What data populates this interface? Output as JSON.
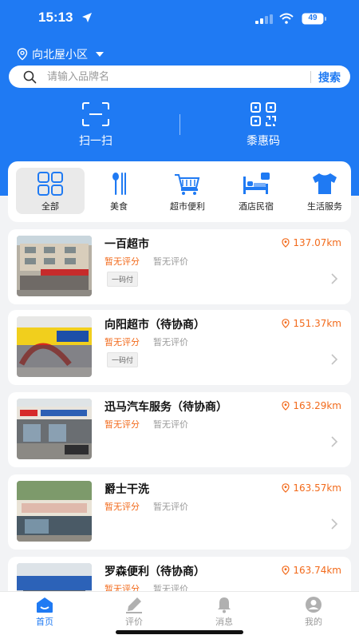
{
  "status_bar": {
    "time": "15:13",
    "battery": "49"
  },
  "location": {
    "name": "向北屋小区"
  },
  "search": {
    "placeholder": "请输入品牌名",
    "button_label": "搜索"
  },
  "quick_actions": [
    {
      "label": "扫一扫",
      "icon": "scan-icon"
    },
    {
      "label": "黍惠码",
      "icon": "qr-code-icon"
    }
  ],
  "categories": [
    {
      "label": "全部",
      "icon": "grid-icon",
      "active": true
    },
    {
      "label": "美食",
      "icon": "food-utensils-icon"
    },
    {
      "label": "超市便利",
      "icon": "shopping-cart-icon"
    },
    {
      "label": "酒店民宿",
      "icon": "hotel-bed-icon"
    },
    {
      "label": "生活服务",
      "icon": "tshirt-icon"
    }
  ],
  "stores": [
    {
      "name": "一百超市",
      "distance": "137.07km",
      "score": "暂无评分",
      "review": "暂无评价",
      "tag": "一码付"
    },
    {
      "name": "向阳超市（待协商）",
      "distance": "151.37km",
      "score": "暂无评分",
      "review": "暂无评价",
      "tag": "一码付"
    },
    {
      "name": "迅马汽车服务（待协商）",
      "distance": "163.29km",
      "score": "暂无评分",
      "review": "暂无评价"
    },
    {
      "name": "爵士干洗",
      "distance": "163.57km",
      "score": "暂无评分",
      "review": "暂无评价"
    },
    {
      "name": "罗森便利（待协商）",
      "distance": "163.74km",
      "score": "暂无评分",
      "review": "暂无评价"
    }
  ],
  "tabbar": [
    {
      "label": "首页",
      "icon": "home-icon",
      "active": true
    },
    {
      "label": "评价",
      "icon": "edit-icon"
    },
    {
      "label": "消息",
      "icon": "bell-icon"
    },
    {
      "label": "我的",
      "icon": "user-icon"
    }
  ],
  "colors": {
    "brand": "#1f7af3",
    "accent": "#f26a1b"
  }
}
